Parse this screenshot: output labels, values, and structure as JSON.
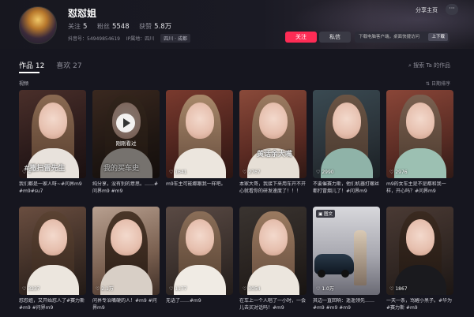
{
  "profile": {
    "name": "怼怼姐",
    "follow_label": "关注",
    "follow_count": "5",
    "fans_label": "粉丝",
    "fans_count": "5548",
    "likes_label": "获赞",
    "likes_count": "5.8万",
    "douyin_id": "抖音号：54949854619",
    "ip": "IP属地：四川",
    "location": "四川 · 成都"
  },
  "header": {
    "share_label": "分享主页",
    "more_label": "···",
    "follow_button": "关注",
    "message_button": "私信",
    "download_text": "下载电脑客户端，桌面快捷访问",
    "download_button": "上下载"
  },
  "tabs": [
    {
      "label": "作品",
      "count": "12"
    },
    {
      "label": "喜欢",
      "count": "27"
    }
  ],
  "search": {
    "placeholder": "搜索 Ta 的作品"
  },
  "section_label": "视频",
  "sort_label": "日期排序",
  "videos": [
    {
      "likes": "4",
      "caption": "我们都是一家人呀~#问界m9 #m9#su7",
      "overlay": "#撒扫雷先生"
    },
    {
      "likes": "",
      "caption": "纯分享，没有别的意思。……#问界m9 #m9",
      "overlay": "我的买车史",
      "watched": "刚刚看过"
    },
    {
      "likes": "1641",
      "caption": "m9车主可能都跟我一样吧。"
    },
    {
      "likes": "2767",
      "caption": "本家大哥，我接下来用车开不开心就看你的研发速度了！！！",
      "overlay": "黄话余大嘴"
    },
    {
      "likes": "2990",
      "caption": "不要催赛力斯，他们机器打螺丝都打冒烟儿了！#问界m9"
    },
    {
      "likes": "2976",
      "caption": "m9的女车主是不是都和我一样，开心吗？#问界m9"
    },
    {
      "likes": "3237",
      "caption": "怼怼姐，又开始怼人了#赛力斯 #m9 #问界m9"
    },
    {
      "likes": "2.1万",
      "caption": "问界专治嘴硬的人！#m9 #问界m9"
    },
    {
      "likes": "1177",
      "caption": "无语了……#m9"
    },
    {
      "likes": "3054",
      "caption": "在车上一个人唱了一小时，一会儿去买对话吗！#m9"
    },
    {
      "likes": "1.0万",
      "caption": "其边一直回响：遥遥领先…… #m9 #m9 #m9",
      "badge": "图文"
    },
    {
      "likes": "1867",
      "caption": "一天一条，骂醒小黑子。#华为 #赛力斯 #m9"
    }
  ]
}
